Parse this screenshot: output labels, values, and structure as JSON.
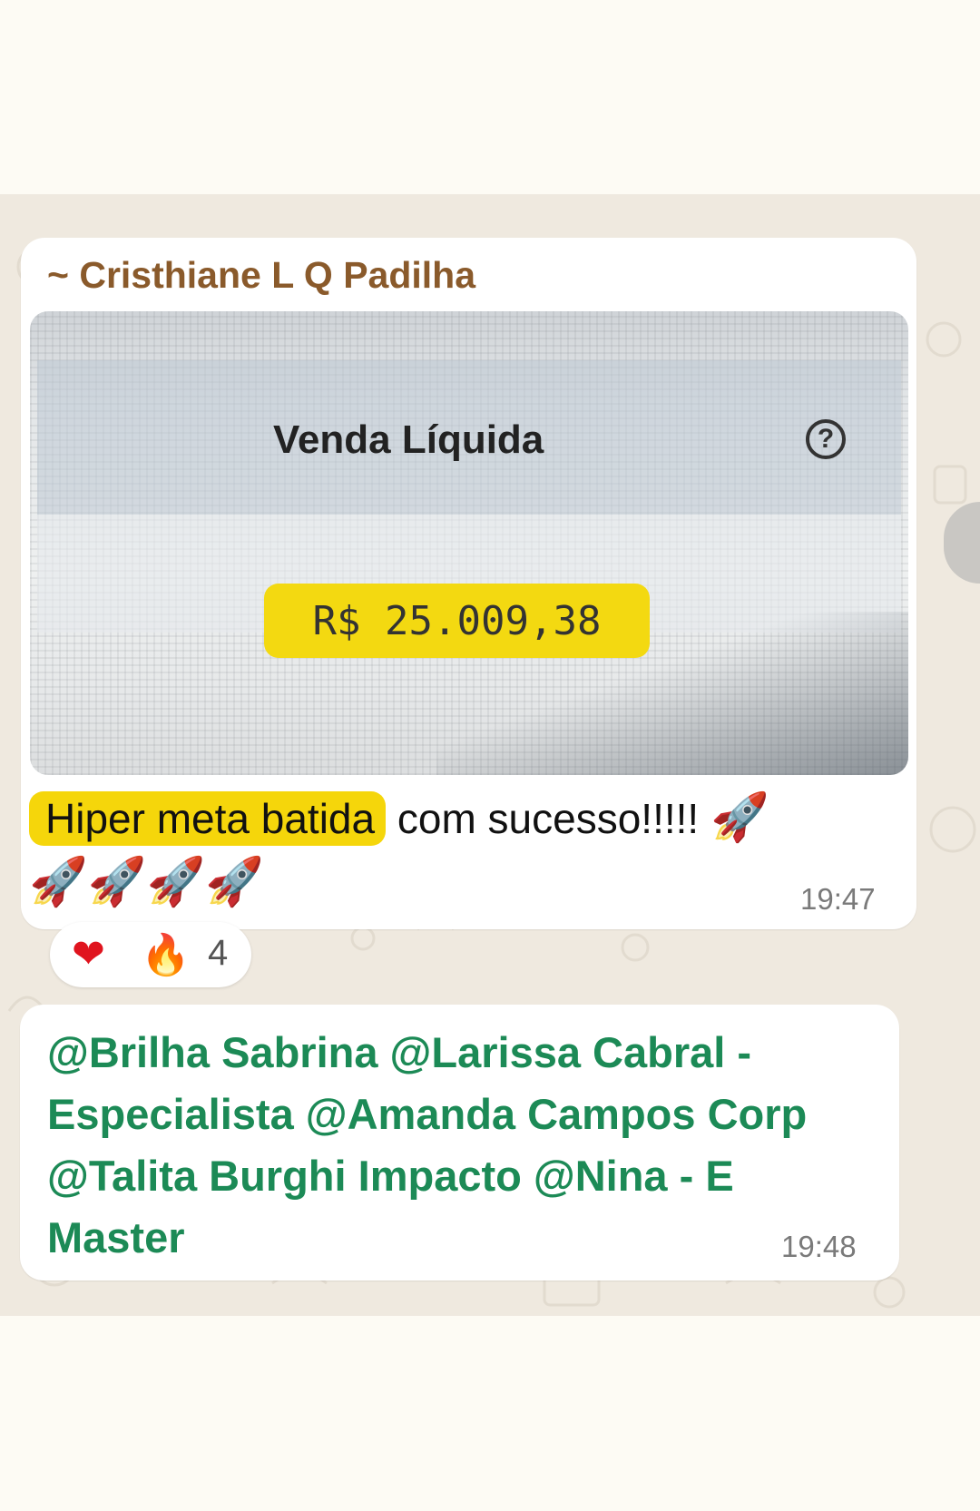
{
  "message1": {
    "sender": "~ Cristhiane L Q Padilha",
    "image": {
      "title": "Venda Líquida",
      "help_symbol": "?",
      "value": "R$ 25.009,38"
    },
    "caption_highlight": "Hiper meta batida",
    "caption_rest": " com sucesso!!!!! ",
    "rockets": "🚀",
    "rocket_line": "🚀🚀🚀🚀",
    "time": "19:47",
    "reactions": {
      "heart": "❤",
      "fire": "🔥",
      "count": "4"
    }
  },
  "message2": {
    "text": "@Brilha Sabrina @Larissa Cabral - Especialista @Amanda Campos Corp @Talita Burghi Impacto @Nina - E Master",
    "time": "19:48"
  },
  "colors": {
    "sender": "#8a5a2b",
    "mention": "#1c8a56",
    "highlight": "#f5d60b",
    "chat_bg": "#efe9df"
  }
}
